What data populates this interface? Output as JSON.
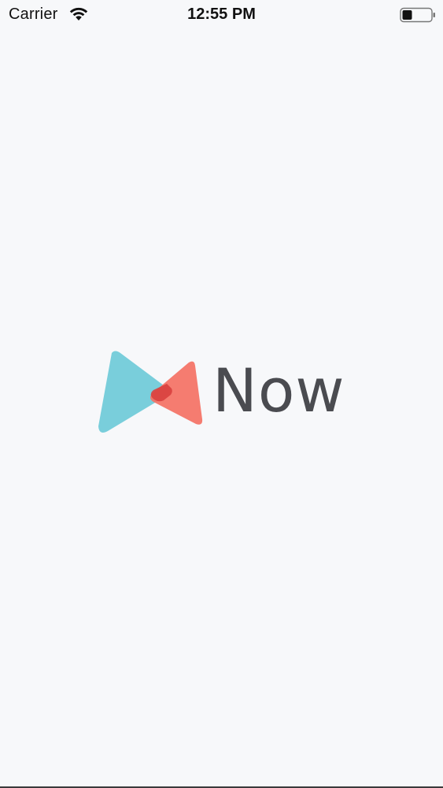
{
  "status_bar": {
    "carrier": "Carrier",
    "time": "12:55 PM",
    "wifi_icon": "wifi-icon",
    "battery_icon": "battery-icon",
    "battery_level": 0.35
  },
  "splash": {
    "brand_name": "Now",
    "logo_icon": "now-logo-icon",
    "colors": {
      "teal": "#6ecad8",
      "coral": "#f47164",
      "overlap": "#d9403e",
      "wordmark": "#4a4b50",
      "background": "#f7f8fa"
    }
  }
}
